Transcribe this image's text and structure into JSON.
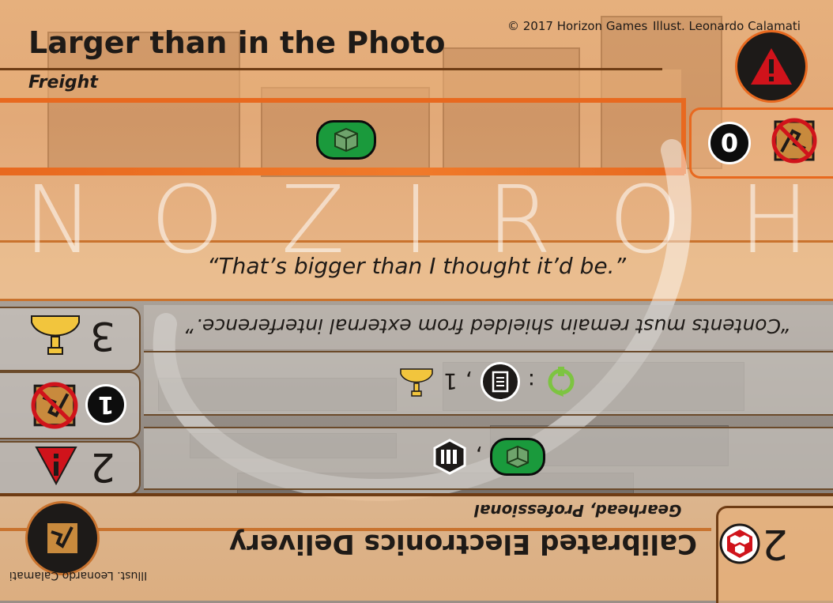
{
  "card": {
    "title": "Larger than in the Photo",
    "type": "Freight",
    "copyright": "© 2017 Horizon Games",
    "illustrator": "Illust. Leonardo Calamati",
    "flavor": "“That’s bigger than I thought it’d be.”",
    "badge_number": "0",
    "watermark_letters": [
      "N",
      "O",
      "Z",
      "I",
      "R",
      "O",
      "H"
    ]
  },
  "reverse": {
    "title": "Calibrated Electronics Delivery",
    "subtitle": "Gearhead, Professional",
    "flavor": "“Contents must remain shielded from external interference.”",
    "illustrator": "Illust. Leonardo Calamati",
    "cost": "2",
    "stats": [
      {
        "value": "3",
        "icon": "trophy-icon"
      },
      {
        "value": "1",
        "icon": "no-agility-icon"
      },
      {
        "value": "2",
        "icon": "danger-triangle-icon"
      }
    ],
    "reward_line": {
      "separator": ":",
      "separator2": ",",
      "count": "1"
    },
    "requirement_line": {
      "separator": ","
    }
  },
  "colors": {
    "accent_orange": "#e8691f",
    "danger_red": "#d0131b",
    "freight_green": "#1a9a3c",
    "gold": "#f2c53d"
  }
}
